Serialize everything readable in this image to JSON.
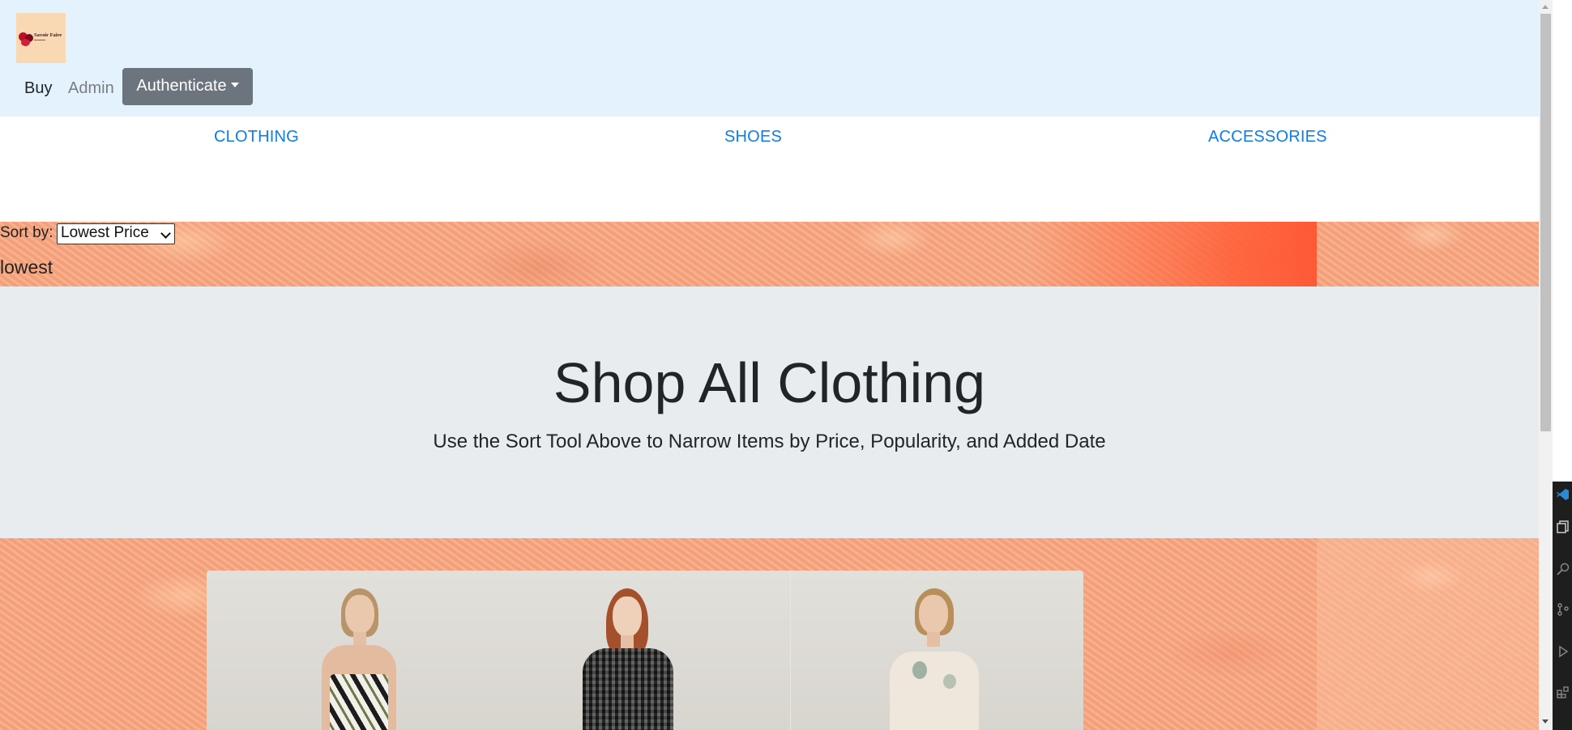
{
  "navbar": {
    "logo_text": "Savoir Faire",
    "links": {
      "buy": "Buy",
      "admin": "Admin"
    },
    "auth_button": "Authenticate"
  },
  "categories": [
    "CLOTHING",
    "SHOES",
    "ACCESSORIES"
  ],
  "sort": {
    "label": "Sort by:",
    "selected": "Lowest Price",
    "current_value": "lowest"
  },
  "jumbotron": {
    "title": "Shop All Clothing",
    "subtitle": "Use the Sort Tool Above to Narrow Items by Price, Popularity, and Added Date"
  },
  "products": [
    {
      "image": "model-in-patterned-dress"
    },
    {
      "image": "model-in-gingham-shirt"
    },
    {
      "image": "model-in-floral-blouse"
    }
  ],
  "colors": {
    "navbar_bg": "#e3f2fd",
    "link_blue": "#0d7ee8",
    "button_gray": "#6c757d",
    "jumbotron_bg": "#e9ecef",
    "texture_base": "#f5a57f"
  },
  "activity_bar": {
    "icons": [
      "vscode-icon",
      "explorer-icon",
      "search-icon",
      "source-control-icon",
      "debug-icon",
      "extensions-icon"
    ]
  }
}
